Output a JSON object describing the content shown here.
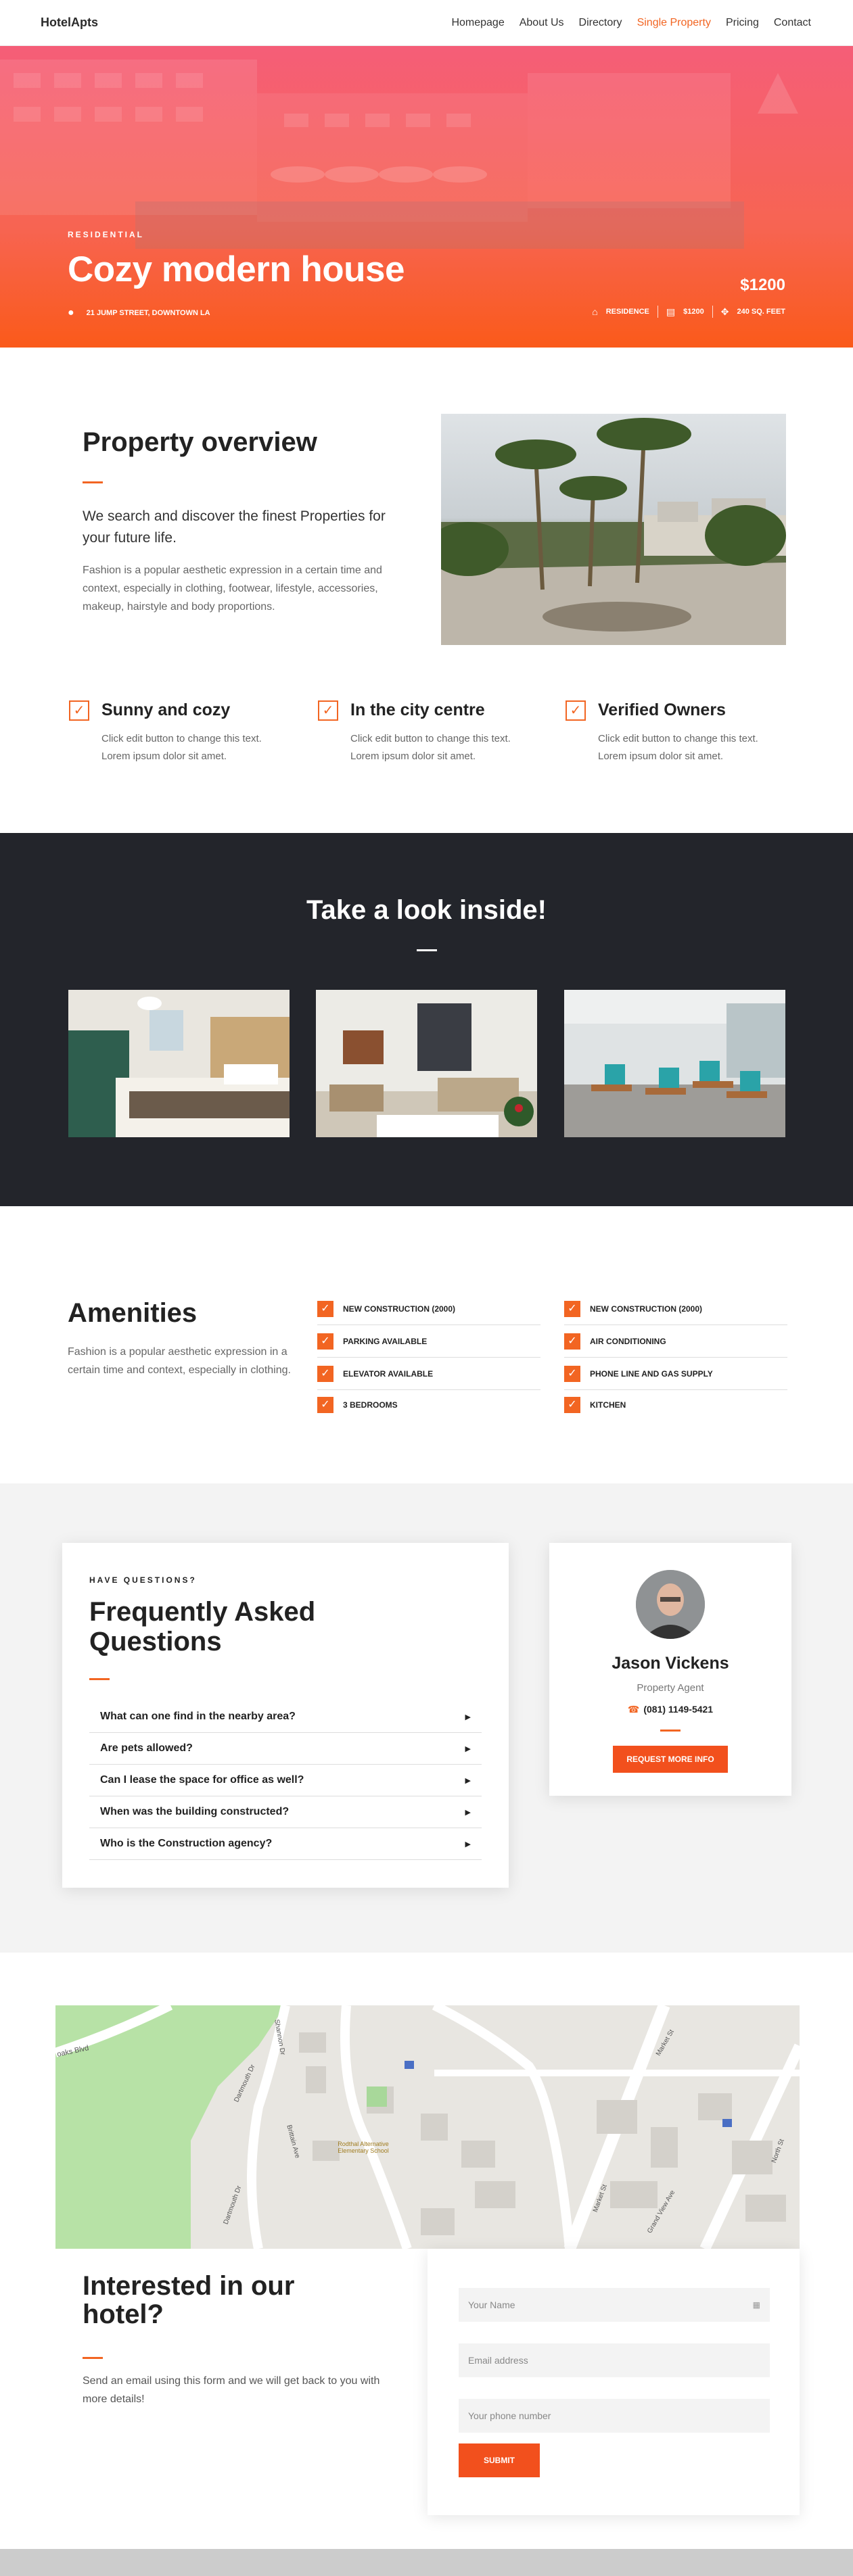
{
  "nav": {
    "logo": "HotelApts",
    "items": [
      "Homepage",
      "About Us",
      "Directory",
      "Single Property",
      "Pricing",
      "Contact"
    ],
    "active_index": 3
  },
  "hero": {
    "tag": "RESIDENTIAL",
    "title": "Cozy modern house",
    "address": "21 JUMP STREET, DOWNTOWN LA",
    "price": "$1200",
    "meta": [
      "RESIDENCE",
      "$1200",
      "240 SQ. FEET"
    ]
  },
  "overview": {
    "title": "Property overview",
    "lead": "We search and discover the finest Properties for your future life.",
    "body": "Fashion is a popular aesthetic expression in a certain time and context, especially in clothing, footwear, lifestyle, accessories, makeup, hairstyle and body proportions."
  },
  "features": [
    {
      "title": "Sunny and cozy",
      "text": "Click edit button to change this text. Lorem ipsum dolor sit amet."
    },
    {
      "title": "In the city centre",
      "text": "Click edit button to change this text. Lorem ipsum dolor sit amet."
    },
    {
      "title": "Verified Owners",
      "text": "Click edit button to change this text. Lorem ipsum dolor sit amet."
    }
  ],
  "inside": {
    "title": "Take a look inside!"
  },
  "amenities": {
    "title": "Amenities",
    "body": "Fashion is a popular aesthetic expression in a certain time and context, especially in clothing.",
    "col1": [
      "NEW CONSTRUCTION (2000)",
      "PARKING AVAILABLE",
      "ELEVATOR AVAILABLE",
      "3 BEDROOMS"
    ],
    "col2": [
      "NEW CONSTRUCTION (2000)",
      "AIR CONDITIONING",
      "PHONE LINE AND GAS SUPPLY",
      "KITCHEN"
    ]
  },
  "faq": {
    "tag": "HAVE QUESTIONS?",
    "title": "Frequently Asked Questions",
    "items": [
      "What can one find in the nearby area?",
      "Are pets allowed?",
      "Can I lease the space for office as well?",
      "When was the building constructed?",
      "Who is the Construction agency?"
    ]
  },
  "agent": {
    "name": "Jason Vickens",
    "role": "Property Agent",
    "phone": "(081) 1149-5421",
    "button": "REQUEST MORE INFO"
  },
  "map": {
    "streets": [
      "oaks Blvd",
      "Shannon Dr",
      "Dartmouth Dr",
      "Brittain Ave",
      "Market St",
      "Grand View Ave",
      "North St",
      "Dartmouth Dr"
    ],
    "poi": "Rodthal Alternative Elementary School"
  },
  "contact": {
    "title": "Interested in our hotel?",
    "body": "Send an email using this form and we will get back to you with more details!",
    "name_placeholder": "Your Name",
    "email_placeholder": "Email address",
    "phone_placeholder": "Your phone number",
    "submit": "SUBMIT"
  },
  "colors": {
    "accent": "#f26522",
    "dark_section": "#23252b",
    "hero_top": "#f55e78",
    "hero_bottom": "#fa5a1a"
  }
}
